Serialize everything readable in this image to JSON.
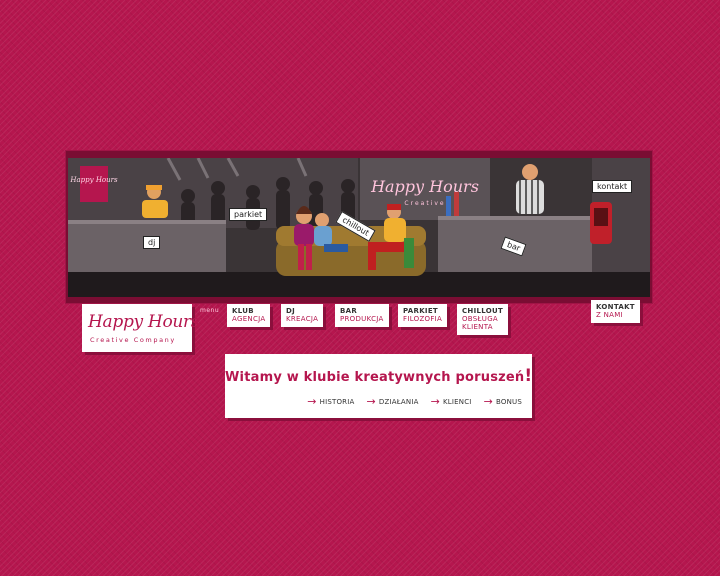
{
  "banner": {
    "neon_sign": {
      "title": "Happy Hours",
      "subtitle": "Creative"
    },
    "poster_text": "Happy Hours",
    "stickers": {
      "dj": "dj",
      "parkiet": "parkiet",
      "chillout": "chillout",
      "bar": "bar",
      "kontakt": "kontakt"
    }
  },
  "logo": {
    "title": "Happy Hours",
    "subtitle": "Creative Company"
  },
  "menu_label": "menu",
  "nav": [
    {
      "top": "KLUB",
      "bottom": "AGENCJA"
    },
    {
      "top": "DJ",
      "bottom": "KREACJA"
    },
    {
      "top": "BAR",
      "bottom": "PRODUKCJA"
    },
    {
      "top": "PARKIET",
      "bottom": "FILOZOFIA"
    },
    {
      "top": "CHILLOUT",
      "bottom": "OBSŁUGA KLIENTA"
    },
    {
      "top": "KONTAKT",
      "bottom": "Z NAMI"
    }
  ],
  "welcome": {
    "title": "Witamy w klubie kreatywnych poruszeń",
    "exclamation": "!",
    "links": [
      "HISTORIA",
      "DZIAŁANIA",
      "KLIENCI",
      "BONUS"
    ]
  },
  "colors": {
    "background": "#b5164e",
    "accent": "#b5164e",
    "banner_frame": "#7a0d33"
  }
}
